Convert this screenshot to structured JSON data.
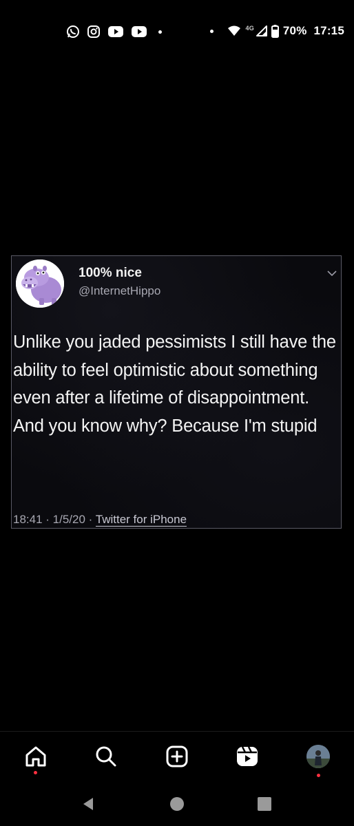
{
  "status_bar": {
    "time": "17:15",
    "battery": "70%",
    "network": "4G",
    "notification_icons": [
      "whatsapp-icon",
      "instagram-icon",
      "youtube-icon",
      "youtube-icon"
    ]
  },
  "tweet": {
    "display_name": "100% nice",
    "handle": "@InternetHippo",
    "text": "Unlike you jaded pessimists I still have the ability to feel optimistic about something even after a lifetime of disappointment. And you know why? Because I'm stupid",
    "time": "18:41",
    "date": "1/5/20",
    "source": "Twitter for iPhone"
  },
  "bottom_nav": {
    "items": [
      "home-icon",
      "search-icon",
      "create-icon",
      "reels-icon",
      "profile-avatar"
    ]
  },
  "colors": {
    "background": "#000000",
    "accent_dot": "#ff3040",
    "handle_gray": "#a8a8b2"
  }
}
